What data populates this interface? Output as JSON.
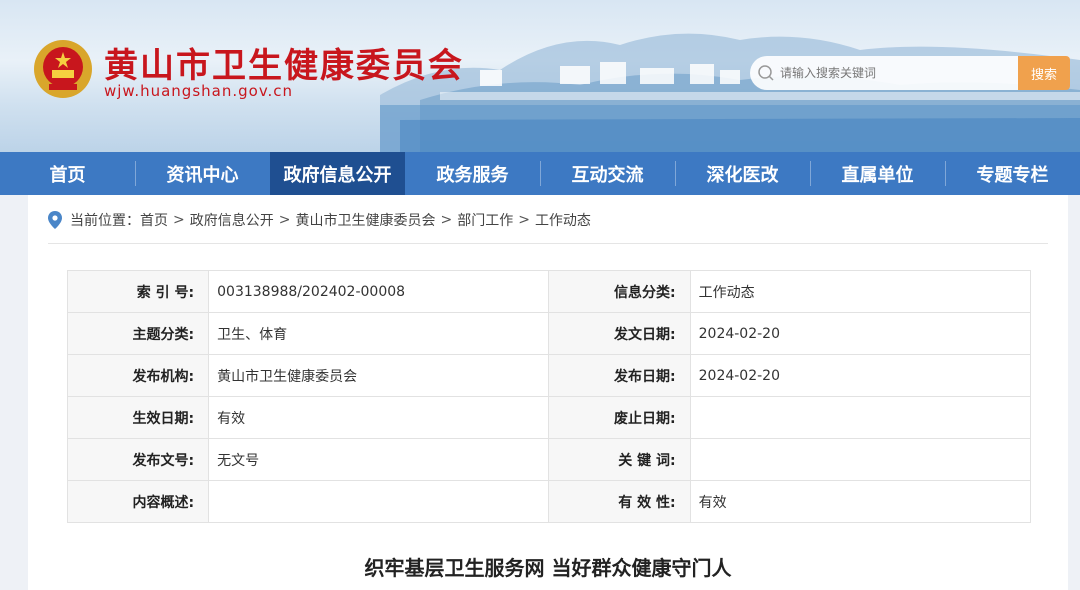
{
  "header": {
    "site_title": "黄山市卫生健康委员会",
    "site_url": "wjw.huangshan.gov.cn",
    "search": {
      "placeholder": "请输入搜索关键词",
      "button_label": "搜索"
    },
    "colors": {
      "title_red": "#c8161d",
      "search_orange": "#f0a14d"
    }
  },
  "nav": {
    "items": [
      {
        "label": "首页"
      },
      {
        "label": "资讯中心"
      },
      {
        "label": "政府信息公开",
        "active": true
      },
      {
        "label": "政务服务"
      },
      {
        "label": "互动交流"
      },
      {
        "label": "深化医改"
      },
      {
        "label": "直属单位"
      },
      {
        "label": "专题专栏"
      }
    ],
    "colors": {
      "bar": "#3d79c3",
      "active": "#1f4f91"
    }
  },
  "breadcrumb": {
    "prefix": "当前位置：",
    "items": [
      "首页",
      "政府信息公开",
      "黄山市卫生健康委员会",
      "部门工作",
      "工作动态"
    ],
    "separator": ">"
  },
  "info_table": {
    "rows": [
      {
        "l1": "索 引 号:",
        "v1": "003138988/202402-00008",
        "l2": "信息分类:",
        "v2": "工作动态"
      },
      {
        "l1": "主题分类:",
        "v1": "卫生、体育",
        "l2": "发文日期:",
        "v2": "2024-02-20"
      },
      {
        "l1": "发布机构:",
        "v1": "黄山市卫生健康委员会",
        "l2": "发布日期:",
        "v2": "2024-02-20"
      },
      {
        "l1": "生效日期:",
        "v1": "有效",
        "l2": "废止日期:",
        "v2": ""
      },
      {
        "l1": "发布文号:",
        "v1": "无文号",
        "l2": "关 键 词:",
        "v2": ""
      },
      {
        "l1": "内容概述:",
        "v1": "",
        "l2": "有 效 性:",
        "v2": "有效"
      }
    ]
  },
  "article": {
    "title": "织牢基层卫生服务网 当好群众健康守门人"
  }
}
